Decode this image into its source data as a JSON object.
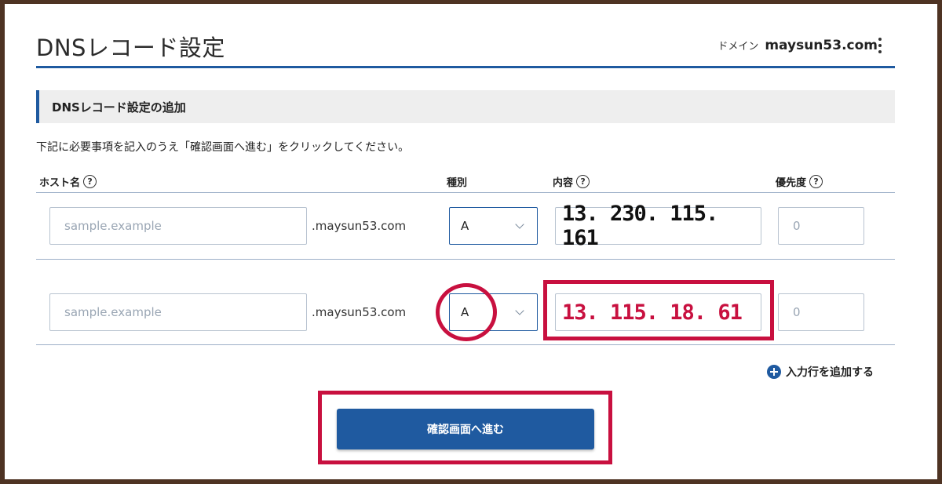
{
  "header": {
    "title": "DNSレコード設定",
    "domain_label": "ドメイン",
    "domain_value": "maysun53.com"
  },
  "section": {
    "title": "DNSレコード設定の追加",
    "instruction": "下記に必要事項を記入のうえ「確認画面へ進む」をクリックしてください。"
  },
  "columns": {
    "host": "ホスト名",
    "type": "種別",
    "content": "内容",
    "priority": "優先度",
    "help_glyph": "?"
  },
  "rows": [
    {
      "host_placeholder": "sample.example",
      "suffix": ".maysun53.com",
      "type": "A",
      "content": "13. 230. 115. 161",
      "priority_placeholder": "0"
    },
    {
      "host_placeholder": "sample.example",
      "suffix": ".maysun53.com",
      "type": "A",
      "content": "13. 115. 18. 61",
      "priority_placeholder": "0"
    }
  ],
  "add_row_label": "入力行を追加する",
  "confirm_button_label": "確認画面へ進む",
  "colors": {
    "accent": "#1f5aa0",
    "highlight": "#c8103f",
    "frame": "#4e3323",
    "row1_content_text": "#111111",
    "row2_content_text": "#c8103f"
  },
  "icons": [
    "help-icon",
    "more-vertical-icon",
    "plus-circle-icon",
    "chevron-down-icon"
  ]
}
